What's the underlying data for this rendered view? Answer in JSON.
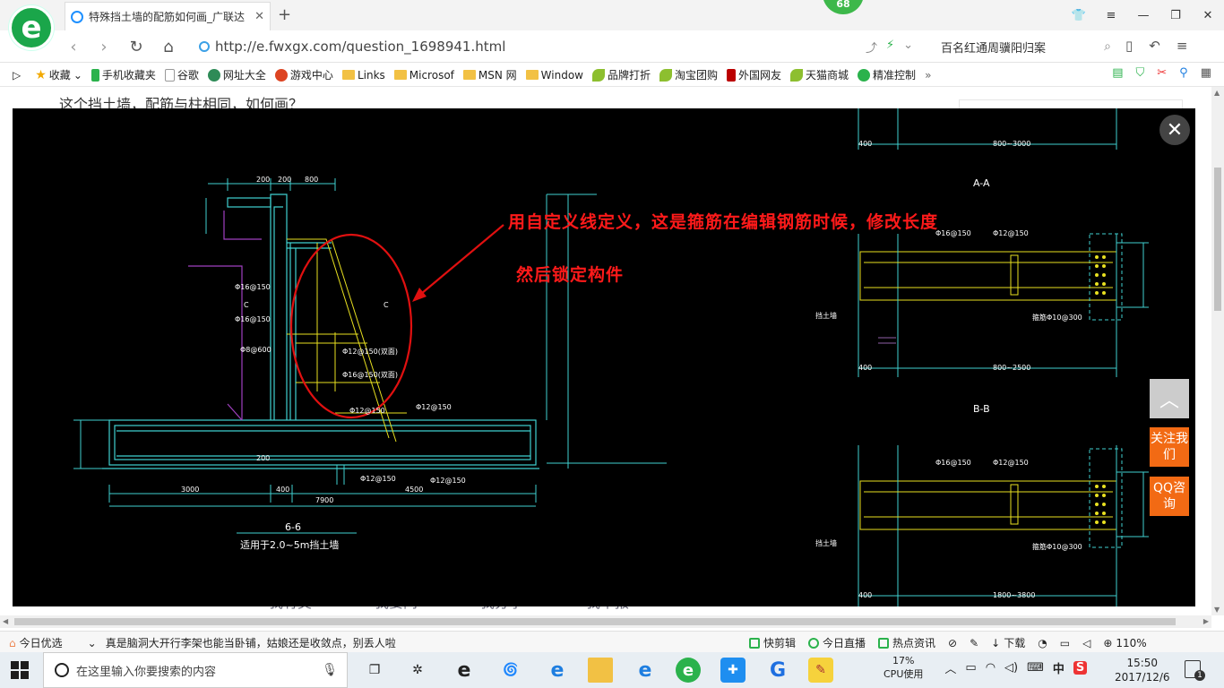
{
  "browser": {
    "tab_title": "特殊挡土墙的配筋如何画_广联达",
    "url": "http://e.fwxgx.com/question_1698941.html",
    "search_text": "百名红通周骥阳归案",
    "badge": "68"
  },
  "bookmarks": [
    {
      "label": "收藏",
      "icon": "star-icon"
    },
    {
      "label": "手机收藏夹",
      "icon": "phone-icon"
    },
    {
      "label": "谷歌",
      "icon": "document-icon"
    },
    {
      "label": "网址大全",
      "icon": "globe-icon"
    },
    {
      "label": "游戏中心",
      "icon": "game-icon"
    },
    {
      "label": "Links",
      "icon": "folder-icon"
    },
    {
      "label": "Microsof",
      "icon": "folder-icon"
    },
    {
      "label": "MSN 网",
      "icon": "folder-icon"
    },
    {
      "label": "Window",
      "icon": "folder-icon"
    },
    {
      "label": "品牌打折",
      "icon": "leaf-icon"
    },
    {
      "label": "淘宝团购",
      "icon": "leaf-icon"
    },
    {
      "label": "外国网友",
      "icon": "bookmark-icon"
    },
    {
      "label": "天猫商城",
      "icon": "leaf-icon"
    },
    {
      "label": "精准控制",
      "icon": "chat-icon"
    }
  ],
  "page": {
    "question": "这个挡土墙，配筋与柱相同，如何画？",
    "bottom_tabs": [
      "我有奖",
      "我要问",
      "我分享",
      "我举报"
    ]
  },
  "viewer": {
    "annotation_line1": "用自定义线定义，这是箍筋在编辑钢筋时候，修改长度",
    "annotation_line2": "然后锁定构件",
    "section_6": "6-6",
    "section_6_caption": "适用于2.0~5m挡土墙",
    "section_aa": "A-A",
    "section_bb": "B-B",
    "dims": {
      "d200a": "200",
      "d200b": "200",
      "d800": "800",
      "d3000": "3000",
      "d400": "400",
      "d4500": "4500",
      "d7900": "7900",
      "d400_aa": "400",
      "d800_3000": "800~3000",
      "d800_2500": "800~2500",
      "d400_bb": "400",
      "d1800": "1800~3800",
      "r1": "Φ16@150",
      "r2": "Φ16@150",
      "r3": "Φ8@600",
      "r4": "Φ12@150(双面)",
      "r5": "Φ16@150(双面)",
      "r6": "Φ12@150",
      "r7": "Φ12@150",
      "r8": "Φ12@150",
      "r9": "Φ12@150",
      "a1": "Φ16@150",
      "a2": "Φ12@150",
      "a3": "箍筋Φ10@300",
      "b1": "Φ16@150",
      "b2": "Φ12@150",
      "b3": "箍筋Φ10@300",
      "label_c1": "C",
      "label_c2": "C",
      "wall_label": "挡土墙"
    }
  },
  "widgets": {
    "follow": "关注我们",
    "qq": "QQ咨询"
  },
  "statusbar": {
    "left_label": "今日优选",
    "headline": "真是脑洞大开行李架也能当卧铺，姑娘还是收敛点，别丢人啦",
    "right_items": [
      "快剪辑",
      "今日直播",
      "热点资讯",
      "下载"
    ],
    "zoom": "110%"
  },
  "taskbar": {
    "search_placeholder": "在这里输入你要搜索的内容",
    "cpu_percent": "17%",
    "cpu_label": "CPU使用",
    "ime": "中",
    "time": "15:50",
    "date": "2017/12/6",
    "notification_count": "1"
  }
}
